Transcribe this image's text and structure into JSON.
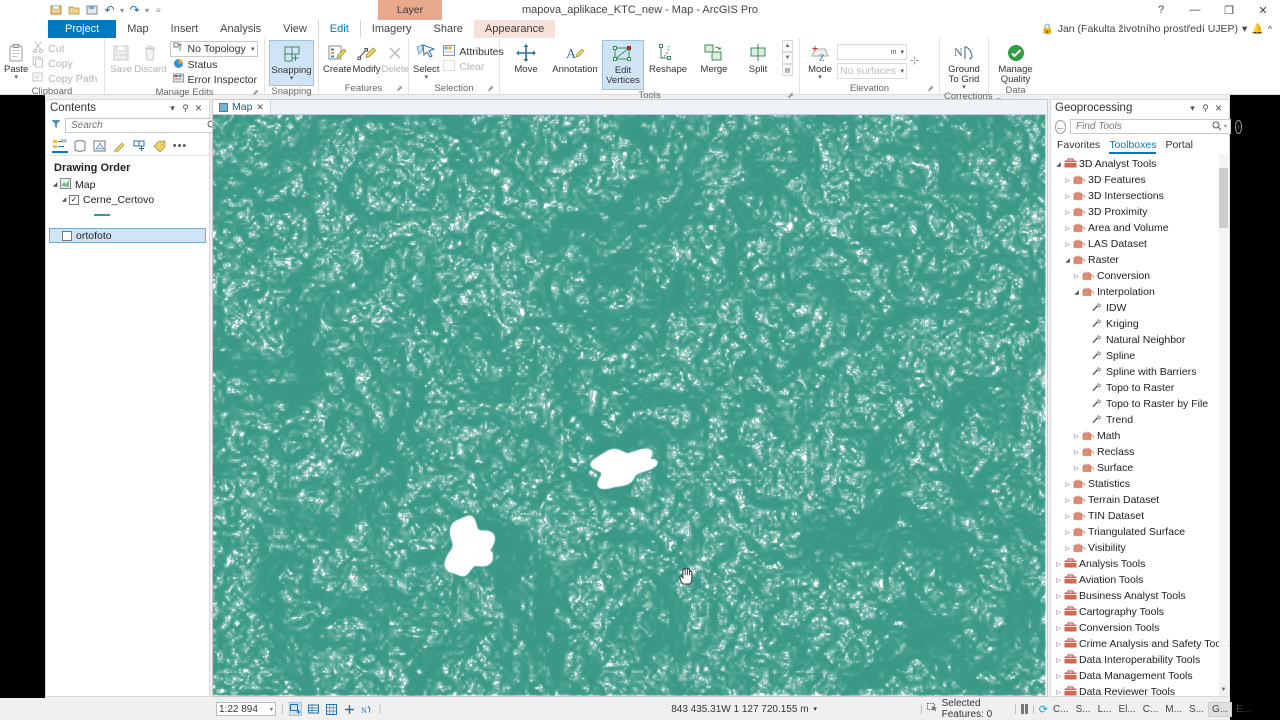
{
  "window": {
    "title": "mapova_aplikace_KTC_new - Map - ArcGIS Pro",
    "help_icon": "?",
    "minimize_icon": "—",
    "maximize_icon": "❐",
    "close_icon": "✕",
    "account": "Jan (Fakulta životního prostředí UJEP)",
    "account_caret": "▾",
    "notification_icon": "bell-icon",
    "collapse_ribbon_icon": "^",
    "lock_icon": "lock-icon"
  },
  "quick_access": {
    "items": [
      "save-project-icon",
      "open-project-icon",
      "save-as-icon",
      "undo-icon",
      "redo-icon",
      "customize-icon"
    ]
  },
  "ribbon": {
    "contextual_header": "Layer",
    "tabs": [
      {
        "label": "Project",
        "state": "backstage"
      },
      {
        "label": "Map",
        "state": "normal"
      },
      {
        "label": "Insert",
        "state": "normal"
      },
      {
        "label": "Analysis",
        "state": "normal"
      },
      {
        "label": "View",
        "state": "normal"
      },
      {
        "label": "Edit",
        "state": "active"
      },
      {
        "label": "Imagery",
        "state": "normal"
      },
      {
        "label": "Share",
        "state": "normal"
      },
      {
        "label": "Appearance",
        "state": "contextual"
      }
    ],
    "groups": [
      {
        "label": "Clipboard",
        "big": [
          {
            "label": "Paste",
            "icon": "paste-icon",
            "caret": "▾"
          }
        ],
        "small": [
          {
            "label": "Cut",
            "icon": "cut-icon",
            "dim": true
          },
          {
            "label": "Copy",
            "icon": "copy-icon",
            "dim": true
          },
          {
            "label": "Copy Path",
            "icon": "copy-path-icon",
            "dim": true
          }
        ]
      },
      {
        "label": "Manage Edits",
        "launcher": "▣",
        "big": [
          {
            "label": "Save",
            "icon": "save-edits-icon",
            "dim": true
          },
          {
            "label": "Discard",
            "icon": "discard-edits-icon",
            "dim": true
          }
        ],
        "topology": "No Topology",
        "small": [
          {
            "label": "Status",
            "icon": "status-icon"
          },
          {
            "label": "Error Inspector",
            "icon": "error-inspector-icon"
          }
        ]
      },
      {
        "label": "Snapping",
        "big": [
          {
            "label": "Snapping",
            "icon": "snapping-icon",
            "caret": "▾",
            "selected": true
          }
        ]
      },
      {
        "label": "Features",
        "launcher": "▣",
        "big": [
          {
            "label": "Create",
            "icon": "create-features-icon"
          },
          {
            "label": "Modify",
            "icon": "modify-features-icon"
          },
          {
            "label": "Delete",
            "icon": "delete-icon",
            "dim": true
          }
        ]
      },
      {
        "label": "Selection",
        "launcher": "▣",
        "big": [
          {
            "label": "Select",
            "icon": "select-icon",
            "caret": "▾"
          }
        ],
        "small": [
          {
            "label": "Attributes",
            "icon": "attributes-icon"
          },
          {
            "label": "Clear",
            "icon": "clear-selection-icon",
            "dim": true
          }
        ]
      },
      {
        "label": "Tools",
        "launcher": "▣",
        "big": [
          {
            "label": "Move",
            "icon": "move-icon"
          },
          {
            "label": "Annotation",
            "icon": "annotation-icon"
          },
          {
            "label": "Edit Vertices",
            "icon": "edit-vertices-icon",
            "selected": true
          },
          {
            "label": "Reshape",
            "icon": "reshape-icon"
          },
          {
            "label": "Merge",
            "icon": "merge-icon"
          },
          {
            "label": "Split",
            "icon": "split-icon"
          }
        ]
      },
      {
        "label": "Elevation",
        "big": [
          {
            "label": "Mode",
            "icon": "elevation-mode-icon",
            "caret": "▾"
          }
        ],
        "fields": [
          {
            "value": "",
            "placeholder": "m",
            "dim": true
          },
          {
            "value": "",
            "placeholder": "No surfaces",
            "dim": true
          }
        ]
      },
      {
        "label": "Corrections",
        "big": [
          {
            "label": "Ground To Grid",
            "icon": "ground-to-grid-icon",
            "caret": "▾"
          }
        ]
      },
      {
        "label": "Data Reviewer",
        "big": [
          {
            "label": "Manage Quality",
            "icon": "manage-quality-icon"
          }
        ]
      }
    ]
  },
  "contents_pane": {
    "title": "Contents",
    "pin_icon": "pin-icon",
    "menu_icon": "▾",
    "close_icon": "✕",
    "search": {
      "placeholder": "Search",
      "value": "",
      "icon": "search-icon"
    },
    "filter_icon": "filter-icon",
    "toolbar_icons": [
      "list-by-drawing-order-icon",
      "list-by-data-source-icon",
      "list-by-selection-icon",
      "list-by-editing-icon",
      "list-by-snapping-icon",
      "list-by-labeling-icon",
      "more-icon"
    ],
    "heading": "Drawing Order",
    "tree": [
      {
        "label": "Map",
        "indent": 0,
        "icon": "map-icon",
        "expander": "▾"
      },
      {
        "label": "Cerne_Certovo",
        "indent": 1,
        "icon": "checkbox-checked",
        "expander": "▾"
      },
      {
        "label": "",
        "indent": 2,
        "icon": "line-symbol"
      },
      {
        "label": "ortofoto",
        "indent": 1,
        "icon": "checkbox-unchecked",
        "selected": true
      }
    ]
  },
  "map_view": {
    "tab_label": "Map",
    "tab_icon": "map-tab-icon",
    "tab_close": "✕",
    "cursor": "hand-cursor"
  },
  "geoprocessing_pane": {
    "title": "Geoprocessing",
    "menu_icon": "▾",
    "pin_icon": "pin-icon",
    "close_icon": "✕",
    "back_icon": "←",
    "add_icon": "+",
    "search": {
      "placeholder": "Find Tools",
      "value": "",
      "icon": "search-icon",
      "dropdown": "▾"
    },
    "tabs": [
      {
        "label": "Favorites",
        "active": false
      },
      {
        "label": "Toolboxes",
        "active": true
      },
      {
        "label": "Portal",
        "active": false
      }
    ],
    "tree": [
      {
        "label": "3D Analyst Tools",
        "indent": 0,
        "expander": "▾",
        "icon": "toolbox-icon"
      },
      {
        "label": "3D Features",
        "indent": 1,
        "expander": "▸",
        "icon": "toolset-icon"
      },
      {
        "label": "3D Intersections",
        "indent": 1,
        "expander": "▸",
        "icon": "toolset-icon"
      },
      {
        "label": "3D Proximity",
        "indent": 1,
        "expander": "▸",
        "icon": "toolset-icon"
      },
      {
        "label": "Area and Volume",
        "indent": 1,
        "expander": "▸",
        "icon": "toolset-icon"
      },
      {
        "label": "LAS Dataset",
        "indent": 1,
        "expander": "▸",
        "icon": "toolset-icon"
      },
      {
        "label": "Raster",
        "indent": 1,
        "expander": "▾",
        "icon": "toolset-icon"
      },
      {
        "label": "Conversion",
        "indent": 2,
        "expander": "▸",
        "icon": "toolset-icon"
      },
      {
        "label": "Interpolation",
        "indent": 2,
        "expander": "▾",
        "icon": "toolset-icon"
      },
      {
        "label": "IDW",
        "indent": 3,
        "expander": "",
        "icon": "tool-icon"
      },
      {
        "label": "Kriging",
        "indent": 3,
        "expander": "",
        "icon": "tool-icon"
      },
      {
        "label": "Natural Neighbor",
        "indent": 3,
        "expander": "",
        "icon": "tool-icon"
      },
      {
        "label": "Spline",
        "indent": 3,
        "expander": "",
        "icon": "tool-icon"
      },
      {
        "label": "Spline with Barriers",
        "indent": 3,
        "expander": "",
        "icon": "tool-icon"
      },
      {
        "label": "Topo to Raster",
        "indent": 3,
        "expander": "",
        "icon": "tool-icon"
      },
      {
        "label": "Topo to Raster by File",
        "indent": 3,
        "expander": "",
        "icon": "tool-icon"
      },
      {
        "label": "Trend",
        "indent": 3,
        "expander": "",
        "icon": "tool-icon"
      },
      {
        "label": "Math",
        "indent": 2,
        "expander": "▸",
        "icon": "toolset-icon"
      },
      {
        "label": "Reclass",
        "indent": 2,
        "expander": "▸",
        "icon": "toolset-icon"
      },
      {
        "label": "Surface",
        "indent": 2,
        "expander": "▸",
        "icon": "toolset-icon"
      },
      {
        "label": "Statistics",
        "indent": 1,
        "expander": "▸",
        "icon": "toolset-icon"
      },
      {
        "label": "Terrain Dataset",
        "indent": 1,
        "expander": "▸",
        "icon": "toolset-icon"
      },
      {
        "label": "TIN Dataset",
        "indent": 1,
        "expander": "▸",
        "icon": "toolset-icon"
      },
      {
        "label": "Triangulated Surface",
        "indent": 1,
        "expander": "▸",
        "icon": "toolset-icon"
      },
      {
        "label": "Visibility",
        "indent": 1,
        "expander": "▸",
        "icon": "toolset-icon"
      },
      {
        "label": "Analysis Tools",
        "indent": 0,
        "expander": "▸",
        "icon": "toolbox-icon"
      },
      {
        "label": "Aviation Tools",
        "indent": 0,
        "expander": "▸",
        "icon": "toolbox-icon"
      },
      {
        "label": "Business Analyst Tools",
        "indent": 0,
        "expander": "▸",
        "icon": "toolbox-icon"
      },
      {
        "label": "Cartography Tools",
        "indent": 0,
        "expander": "▸",
        "icon": "toolbox-icon"
      },
      {
        "label": "Conversion Tools",
        "indent": 0,
        "expander": "▸",
        "icon": "toolbox-icon"
      },
      {
        "label": "Crime Analysis and Safety Tools",
        "indent": 0,
        "expander": "▸",
        "icon": "toolbox-icon"
      },
      {
        "label": "Data Interoperability Tools",
        "indent": 0,
        "expander": "▸",
        "icon": "toolbox-icon"
      },
      {
        "label": "Data Management Tools",
        "indent": 0,
        "expander": "▸",
        "icon": "toolbox-icon"
      },
      {
        "label": "Data Reviewer Tools",
        "indent": 0,
        "expander": "▸",
        "icon": "toolbox-icon"
      }
    ]
  },
  "status_bar": {
    "scale": "1:22 894",
    "scale_caret": "▾",
    "tool_icons": [
      "selected-features-icon",
      "attribute-table-icon",
      "grid-icon",
      "add-data-icon",
      "basemap-icon"
    ],
    "coordinates": "843 435.31W 1 127 720.155 m",
    "coordinates_caret": "▾",
    "selected_features_label": "Selected Features: 0",
    "selected_features_icon": "selection-icon",
    "pause_icon": "pause-drawing-icon",
    "refresh_icon": "refresh-icon",
    "dock_buttons": [
      "C...",
      "S...",
      "L...",
      "El...",
      "C...",
      "M...",
      "S...",
      "G...",
      "E..."
    ],
    "dock_active_index": 7
  },
  "colors": {
    "accent": "#0079c1",
    "contextual": "#e8a88c",
    "contour": "#3a9a86",
    "selection": "#cfe4f5"
  }
}
